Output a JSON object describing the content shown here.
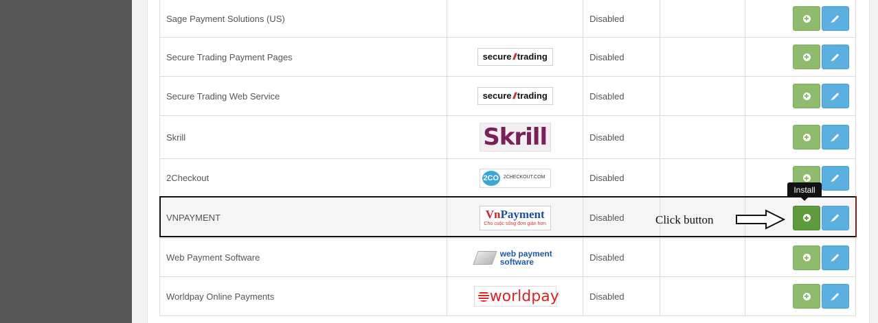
{
  "extensions": [
    {
      "name": "Sage Payment Solutions (US)",
      "logo": "",
      "status": "Disabled"
    },
    {
      "name": "Secure Trading Payment Pages",
      "logo": "secure//trading",
      "status": "Disabled"
    },
    {
      "name": "Secure Trading Web Service",
      "logo": "secure//trading",
      "status": "Disabled"
    },
    {
      "name": "Skrill",
      "logo": "Skrill",
      "status": "Disabled"
    },
    {
      "name": "2Checkout",
      "logo": "2CO 2CHECKOUT.COM",
      "status": "Disabled"
    },
    {
      "name": "VNPAYMENT",
      "logo": "VnPayment",
      "status": "Disabled"
    },
    {
      "name": "Web Payment Software",
      "logo": "web payment software",
      "status": "Disabled"
    },
    {
      "name": "Worldpay Online Payments",
      "logo": "worldpay",
      "status": "Disabled"
    }
  ],
  "logos": {
    "secure_left": "secure",
    "secure_slash": "//",
    "secure_right": "trading",
    "skrill": "Skrill",
    "twoco_circle": "2CO",
    "twoco_text": "2CHECKOUT.COM",
    "vnp_a": "Vn",
    "vnp_b": "Payment",
    "vnp_tagline": "Cho cuộc sống đơn giản hơn",
    "wps_line1": "web payment",
    "wps_line2": "software",
    "worldpay": "worldpay"
  },
  "tooltip": "Install",
  "annotation": "Click button",
  "colors": {
    "install": "#8fbb6c",
    "install_active": "#5f9a3f",
    "edit": "#5bb0e0",
    "sidebar": "#595959"
  },
  "icons": {
    "install": "plus-circle-icon",
    "edit": "pencil-icon"
  }
}
